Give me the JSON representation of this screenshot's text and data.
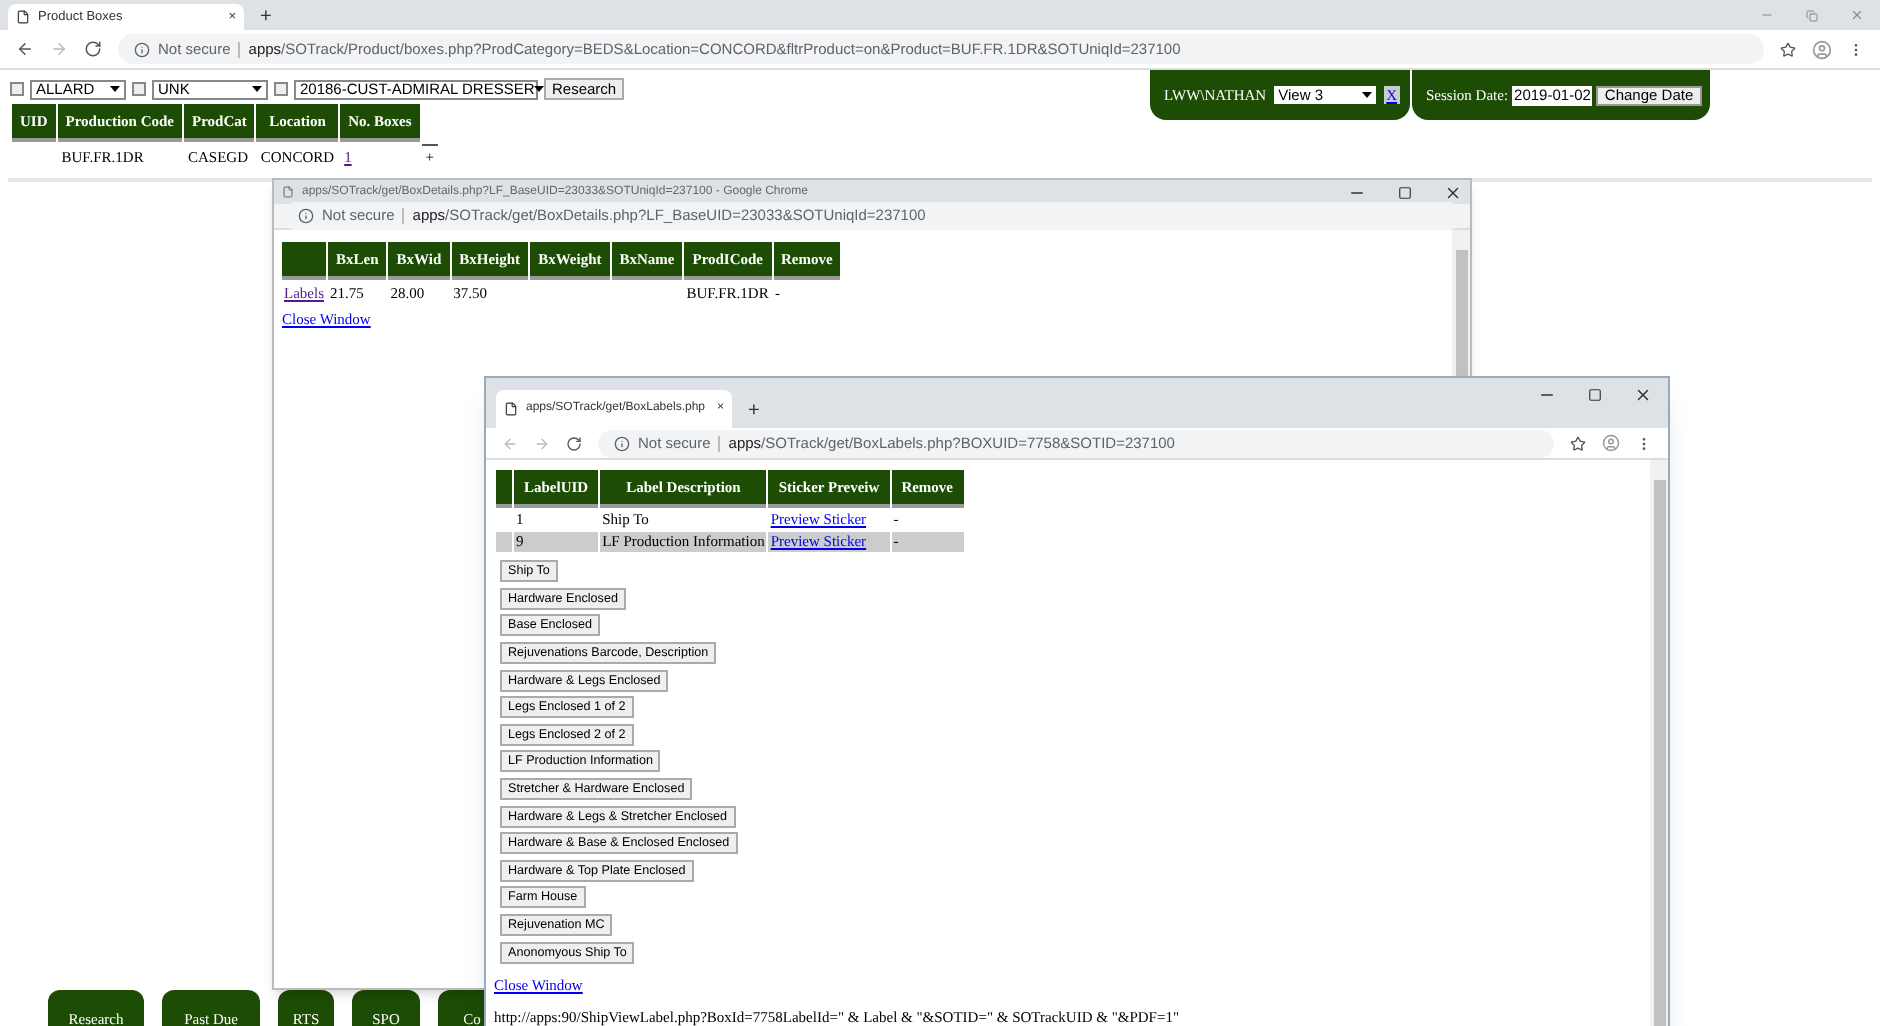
{
  "main_tab": {
    "title": "Product Boxes",
    "close": "×"
  },
  "new_tab": "+",
  "address": {
    "security": "Not secure",
    "host": "apps",
    "path": "/SOTrack/Product/boxes.php?ProdCategory=BEDS&Location=CONCORD&fltrProduct=on&Product=BUF.FR.1DR&SOTUniqId=237100"
  },
  "filters": [
    {
      "checked": false,
      "value": "ALLARD"
    },
    {
      "checked": false,
      "value": "UNK"
    },
    {
      "checked": false,
      "value": "20186-CUST-ADMIRAL DRESSER"
    }
  ],
  "research_button": "Research",
  "products_table": {
    "columns": [
      "UID",
      "Production Code",
      "ProdCat",
      "Location",
      "No. Boxes"
    ],
    "rows": [
      {
        "cells": [
          "",
          "BUF.FR.1DR",
          "CASEGD",
          "CONCORD",
          "1"
        ],
        "extra": "+"
      }
    ]
  },
  "session": {
    "user": "LWW\\NATHAN",
    "view": "View 3",
    "clear": "X",
    "date_label": "Session Date:",
    "date": "2019-01-02",
    "button": "Change Date"
  },
  "details_window": {
    "title": "apps/SOTrack/get/BoxDetails.php?LF_BaseUID=23033&SOTUniqId=237100 - Google Chrome",
    "security": "Not secure",
    "host": "apps",
    "path": "/SOTrack/get/BoxDetails.php?LF_BaseUID=23033&SOTUniqId=237100",
    "columns": [
      "",
      "BxLen",
      "BxWid",
      "BxHeight",
      "BxWeight",
      "BxName",
      "ProdICode",
      "Remove"
    ],
    "rows": [
      {
        "cells": [
          "Labels",
          "21.75",
          "28.00",
          "37.50",
          "",
          "",
          "BUF.FR.1DR",
          "-"
        ]
      }
    ],
    "close_link": "Close Window"
  },
  "labels_window": {
    "tab_title": "apps/SOTrack/get/BoxLabels.php",
    "tab_close": "×",
    "new_tab": "+",
    "security": "Not secure",
    "host": "apps",
    "path": "/SOTrack/get/BoxLabels.php?BOXUID=7758&SOTID=237100",
    "columns": [
      "",
      "LabelUID",
      "Label Description",
      "Sticker Preveiw",
      "Remove"
    ],
    "rows": [
      {
        "highlighted": false,
        "cells": [
          "",
          "1",
          "Ship To",
          "Preview Sticker",
          "-"
        ]
      },
      {
        "highlighted": true,
        "cells": [
          "",
          "9",
          "LF Production Information",
          "Preview Sticker",
          "-"
        ]
      }
    ],
    "buttons": [
      "Ship To",
      "Hardware Enclosed",
      "Base Enclosed",
      "Rejuvenations Barcode, Description",
      "Hardware & Legs Enclosed",
      "Legs Enclosed 1 of 2",
      "Legs Enclosed 2 of 2",
      "LF Production Information",
      "Stretcher & Hardware Enclosed",
      "Hardware & Legs & Stretcher Enclosed",
      "Hardware & Base & Enclosed Enclosed",
      "Hardware & Top Plate Enclosed",
      "Farm House",
      "Rejuvenation MC",
      "Anonomyous Ship To"
    ],
    "close_link": "Close Window",
    "url_text": "http://apps:90/ShipViewLabel.php?BoxId=7758LabelId=\" & Label & \"&SOTID=\" & SOTrackUID & \"&PDF=1\""
  },
  "bottom_nav": [
    "Research",
    "Past Due",
    "RTS",
    "SPO",
    "Co"
  ]
}
